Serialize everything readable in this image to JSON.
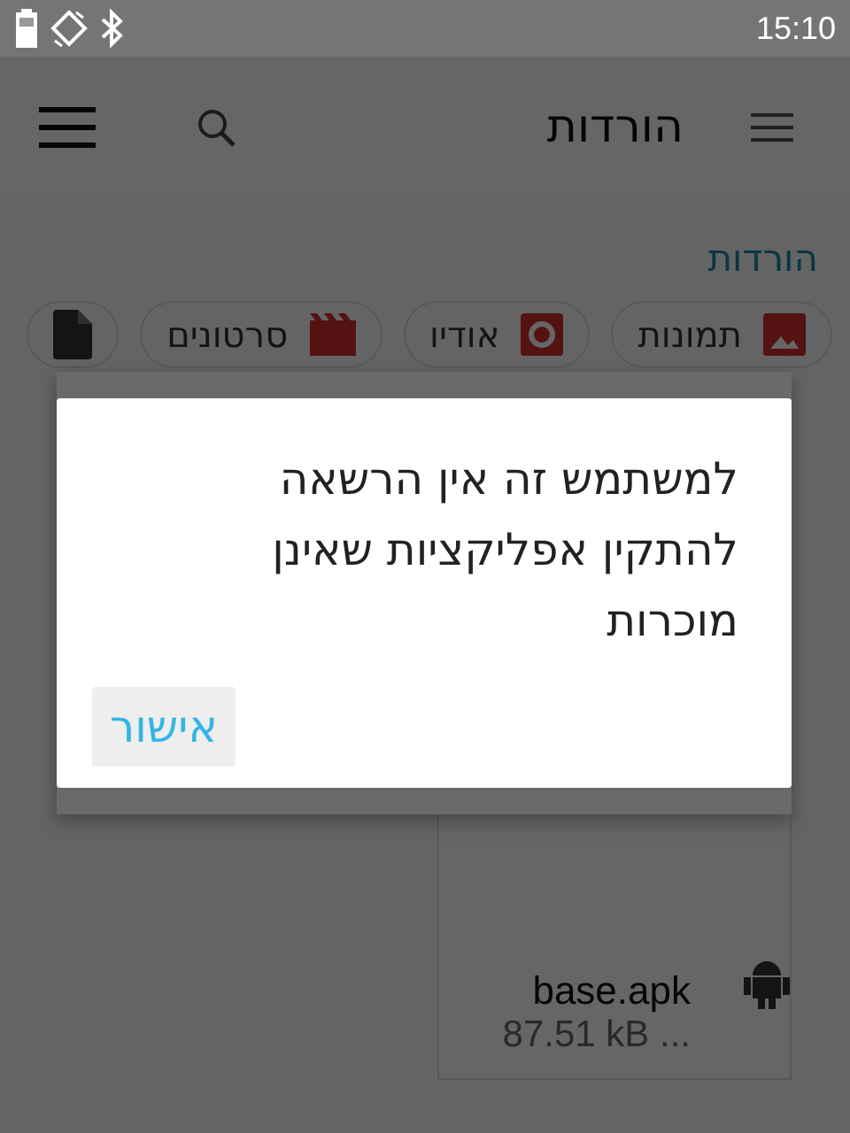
{
  "status_bar": {
    "time": "15:10"
  },
  "toolbar": {
    "title": "הורדות"
  },
  "breadcrumb": "הורדות",
  "chips": [
    {
      "label": "תמונות",
      "kind": "image"
    },
    {
      "label": "אודיו",
      "kind": "audio"
    },
    {
      "label": "סרטונים",
      "kind": "video"
    },
    {
      "kind": "document"
    }
  ],
  "file": {
    "name": "base.apk",
    "size": "87.51 kB ..."
  },
  "dialog": {
    "message": "למשתמש זה אין הרשאה להתקין אפליקציות שאינן מוכרות",
    "button": "אישור"
  }
}
